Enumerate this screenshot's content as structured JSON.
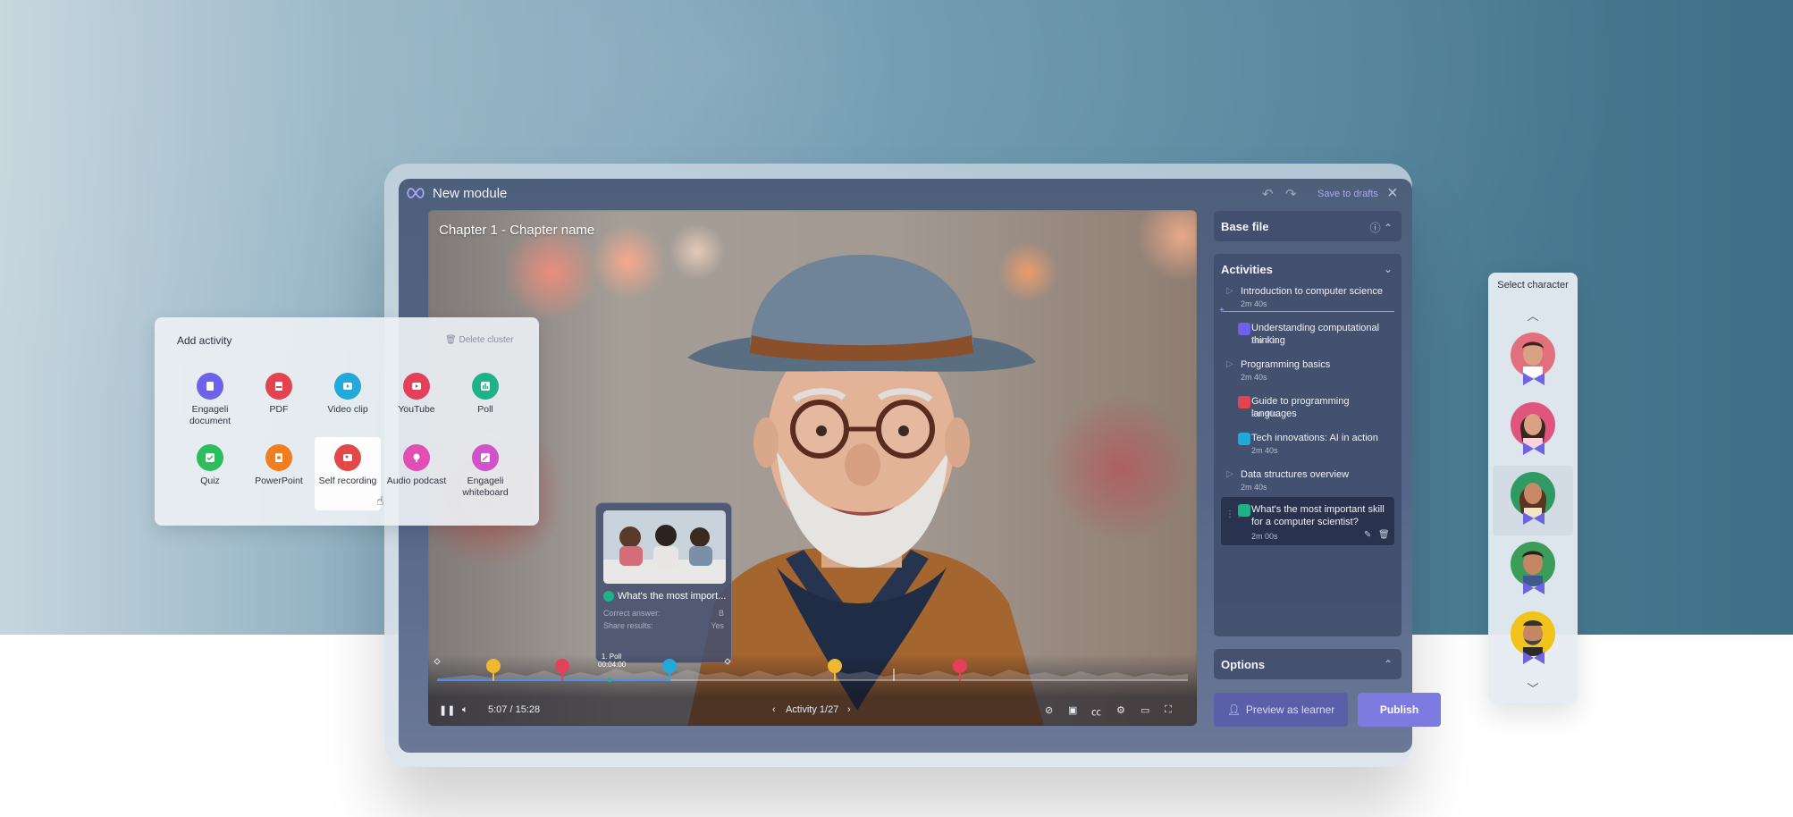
{
  "app": {
    "title": "New module",
    "save_drafts": "Save to drafts"
  },
  "video": {
    "chapter_title": "Chapter 1 - Chapter name",
    "time": "5:07 / 15:28",
    "activity_counter": "Activity 1/27",
    "poll_marker_label": "1. Poll",
    "poll_marker_time": "00:04:00",
    "poll_card": {
      "title": "What's the most import...",
      "correct_answer_label": "Correct answer:",
      "correct_answer_value": "B",
      "share_results_label": "Share results:",
      "share_results_value": "Yes"
    },
    "icons": [
      "pause-icon",
      "volume-icon",
      "chevron-left-icon",
      "chevron-right-icon",
      "hide-icon",
      "clip-icon",
      "captions-icon",
      "settings-icon",
      "theater-icon",
      "fullscreen-icon"
    ]
  },
  "sidebar": {
    "base_file": "Base file",
    "activities_title": "Activities",
    "activities": [
      {
        "label": "Introduction to computer science",
        "duration": "2m 40s",
        "type": "chapter",
        "color": "#8b93ab"
      },
      {
        "label": "Understanding computational thinking",
        "duration": "2m 40s",
        "type": "document",
        "color": "#6d62e8"
      },
      {
        "label": "Programming basics",
        "duration": "2m 40s",
        "type": "chapter",
        "color": "#8b93ab"
      },
      {
        "label": "Guide to programming languages",
        "duration": "2m 40s",
        "type": "pdf",
        "color": "#e3424f"
      },
      {
        "label": "Tech innovations: AI in action",
        "duration": "2m 40s",
        "type": "video",
        "color": "#22a9d8"
      },
      {
        "label": "Data structures overview",
        "duration": "2m 40s",
        "type": "chapter",
        "color": "#8b93ab"
      },
      {
        "label": "What's the most important skill for a computer scientist?",
        "duration": "2m 00s",
        "type": "poll",
        "color": "#1fb28a"
      }
    ],
    "options_title": "Options",
    "preview_label": "Preview as learner",
    "publish_label": "Publish"
  },
  "add_activity": {
    "title": "Add activity",
    "delete_label": "Delete cluster",
    "items": [
      {
        "label": "Engageli document",
        "color": "#6d62e8",
        "icon": "document-icon"
      },
      {
        "label": "PDF",
        "color": "#e3424f",
        "icon": "pdf-icon"
      },
      {
        "label": "Video clip",
        "color": "#22a9d8",
        "icon": "video-clip-icon"
      },
      {
        "label": "YouTube",
        "color": "#e5405a",
        "icon": "youtube-icon"
      },
      {
        "label": "Poll",
        "color": "#1fb28a",
        "icon": "poll-icon"
      },
      {
        "label": "Quiz",
        "color": "#2ebd5c",
        "icon": "quiz-icon"
      },
      {
        "label": "PowerPoint",
        "color": "#f07d1e",
        "icon": "powerpoint-icon"
      },
      {
        "label": "Self recording",
        "color": "#e24a4a",
        "icon": "self-recording-icon"
      },
      {
        "label": "Audio podcast",
        "color": "#e24fb2",
        "icon": "podcast-icon"
      },
      {
        "label": "Engageli whiteboard",
        "color": "#cf53c9",
        "icon": "whiteboard-icon"
      }
    ]
  },
  "characters": {
    "title": "Select character",
    "items": [
      {
        "name": "character-1",
        "bg": "#e26f7c"
      },
      {
        "name": "character-2",
        "bg": "#e0557e"
      },
      {
        "name": "character-3",
        "bg": "#2f9b62"
      },
      {
        "name": "character-4",
        "bg": "#3c9c5a"
      },
      {
        "name": "character-5",
        "bg": "#f2c31b"
      }
    ],
    "selected_index": 2
  },
  "colors": {
    "accent": "#7d7ae0",
    "panel": "#424e6c"
  }
}
